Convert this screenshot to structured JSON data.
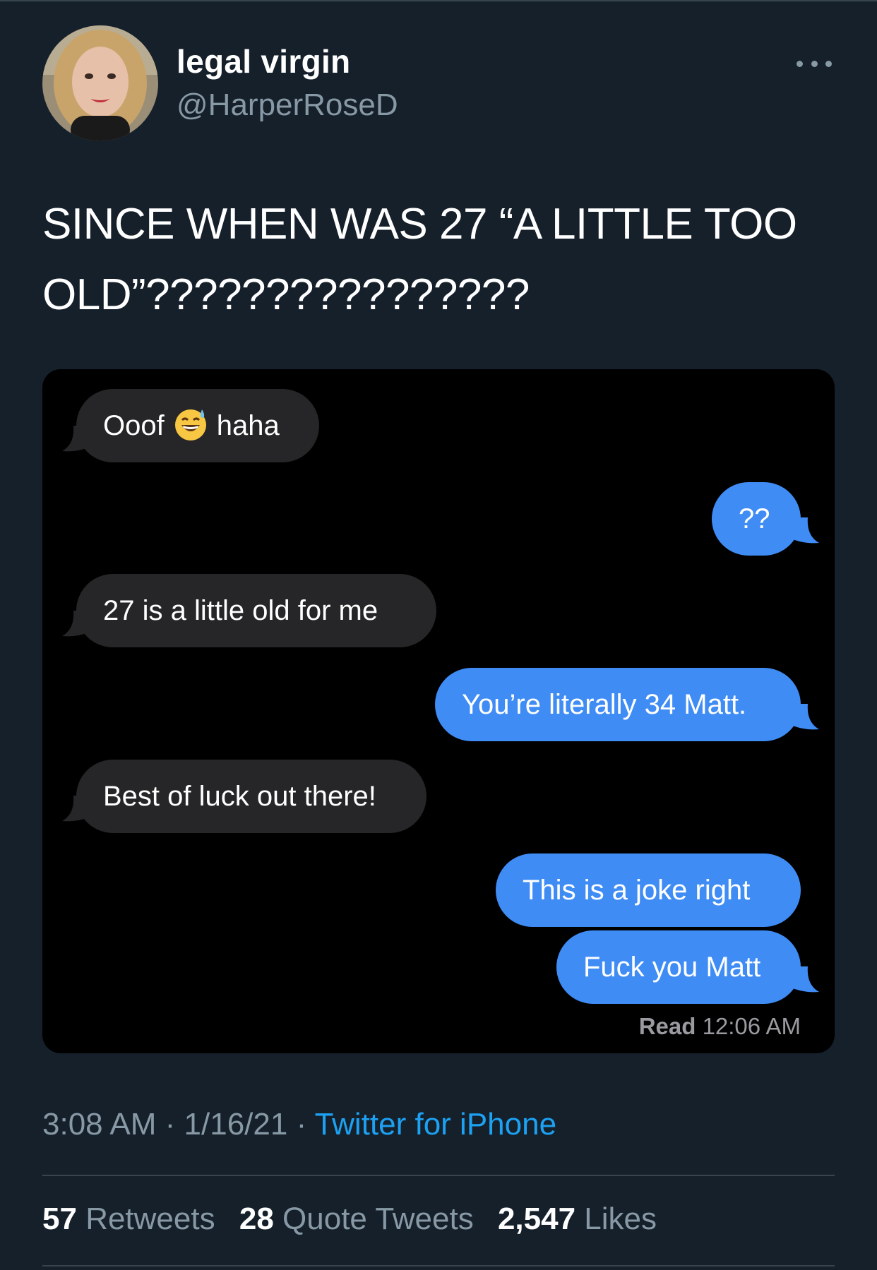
{
  "user": {
    "display_name": "legal virgin",
    "handle": "@HarperRoseD"
  },
  "tweet": {
    "text": "SINCE WHEN WAS 27 “A LITTLE TOO\nOLD”????????????????"
  },
  "screenshot": {
    "messages": [
      {
        "side": "incoming",
        "text_before": "Ooof",
        "emoji": "grinning-sweat-emoji",
        "text_after": "haha"
      },
      {
        "side": "outgoing",
        "text": "??"
      },
      {
        "side": "incoming",
        "text": "27 is a little old for me"
      },
      {
        "side": "outgoing",
        "text": "You’re literally 34 Matt."
      },
      {
        "side": "incoming",
        "text": "Best of luck out there!"
      },
      {
        "side": "outgoing",
        "text": "This is a joke right"
      },
      {
        "side": "outgoing",
        "text": "Fuck you Matt"
      }
    ],
    "read_label": "Read",
    "read_time": "12:06 AM",
    "colors": {
      "incoming": "#262628",
      "outgoing": "#3f8cf5"
    }
  },
  "meta": {
    "time": "3:08 AM",
    "sep1": " · ",
    "date": "1/16/21",
    "sep2": " · ",
    "source": "Twitter for iPhone"
  },
  "stats": {
    "retweets_count": "57",
    "retweets_label": "Retweets",
    "quotes_count": "28",
    "quotes_label": "Quote Tweets",
    "likes_count": "2,547",
    "likes_label": "Likes"
  },
  "icons": {
    "more": "more-horizontal-icon"
  },
  "colors": {
    "background": "#15202b",
    "secondary_text": "#8899a6",
    "link": "#1da1f2"
  }
}
